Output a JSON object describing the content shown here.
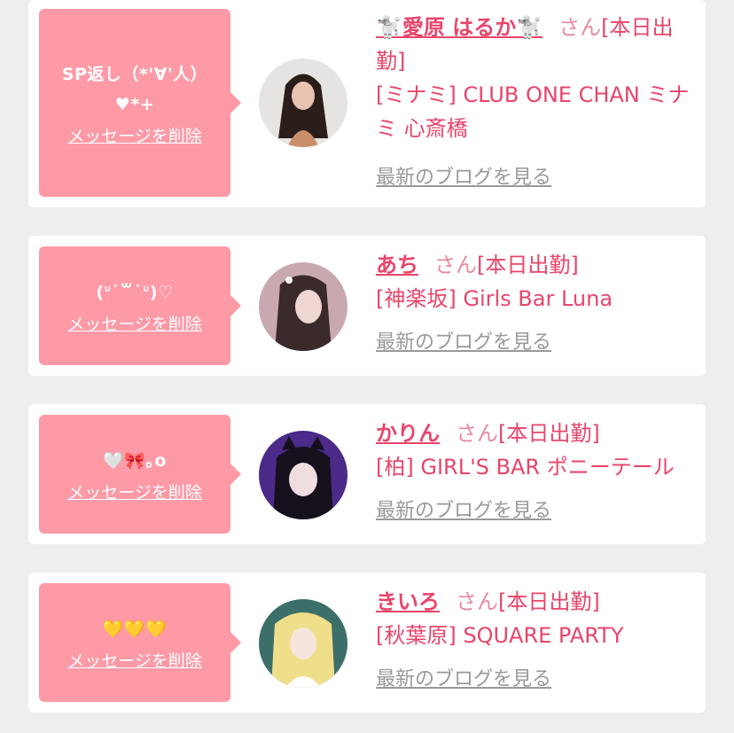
{
  "cards": [
    {
      "message": "SP返し（*'∀'人）♥*+",
      "delete_label": "メッセージを削除",
      "name": "🐩愛原 はるか🐩",
      "honorific": "さん",
      "status": "[本日出勤]",
      "shop": "[ミナミ] CLUB ONE CHAN ミナミ 心斎橋",
      "blog_label": "最新のブログを見る"
    },
    {
      "message": "(ᐡ˙꒳˙ᐡ)♡",
      "delete_label": "メッセージを削除",
      "name": "あち",
      "honorific": "さん",
      "status": "[本日出勤]",
      "shop": "[神楽坂] Girls Bar Luna",
      "blog_label": "最新のブログを見る"
    },
    {
      "message": "🤍🎀｡o",
      "delete_label": "メッセージを削除",
      "name": "かりん",
      "honorific": "さん",
      "status": "[本日出勤]",
      "shop": "[柏] GIRL'S BAR ポニーテール",
      "blog_label": "最新のブログを見る"
    },
    {
      "message": "💛💛💛",
      "delete_label": "メッセージを削除",
      "name": "きいろ",
      "honorific": "さん",
      "status": "[本日出勤]",
      "shop": "[秋葉原] SQUARE PARTY",
      "blog_label": "最新のブログを見る"
    }
  ],
  "colors": {
    "bubble": "#fd9aa6",
    "accent": "#e8456a",
    "honorific": "#e98aa0",
    "link_gray": "#999999",
    "background": "#eeeeee"
  }
}
